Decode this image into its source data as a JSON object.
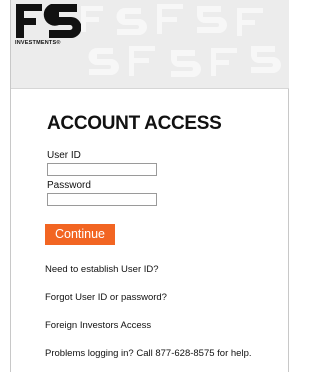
{
  "brand": {
    "logo_letters": "FS",
    "logo_subtitle": "INVESTMENTS®"
  },
  "form": {
    "title": "ACCOUNT ACCESS",
    "user_id_label": "User ID",
    "user_id_value": "",
    "password_label": "Password",
    "password_value": "",
    "continue_label": "Continue"
  },
  "links": [
    {
      "label": "Need to establish User ID?"
    },
    {
      "label": "Forgot User ID or password?"
    },
    {
      "label": "Foreign Investors Access"
    },
    {
      "label": "Problems logging in? Call 877-628-8575 for help."
    }
  ],
  "colors": {
    "accent": "#f26522",
    "header_bg": "#ececec"
  }
}
